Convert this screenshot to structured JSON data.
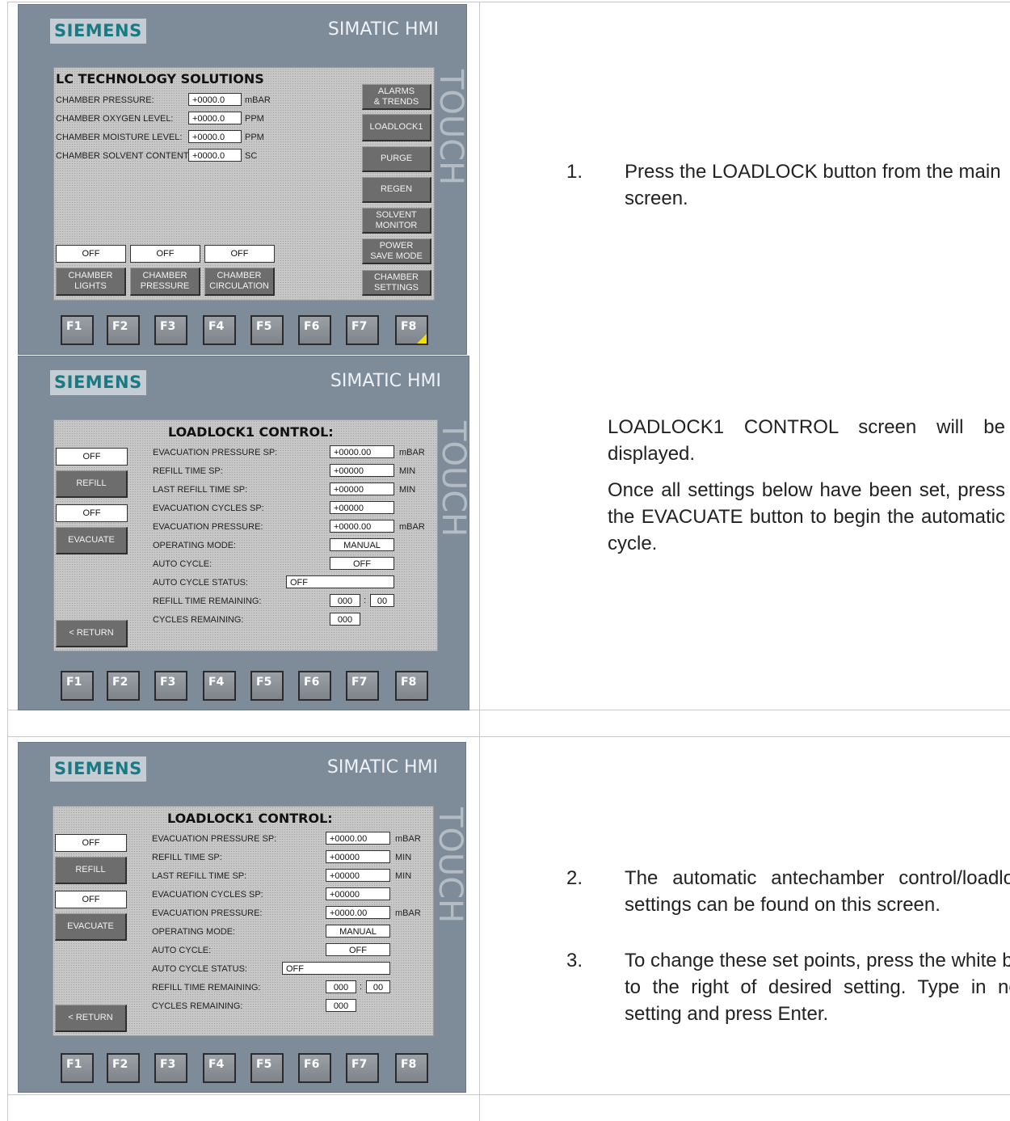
{
  "hmi": {
    "logo": "SIEMENS",
    "brand": "SIMATIC HMI",
    "touch": "TOUCH",
    "fkeys": [
      "F1",
      "F2",
      "F3",
      "F4",
      "F5",
      "F6",
      "F7",
      "F8"
    ]
  },
  "main_screen": {
    "title": "LC TECHNOLOGY SOLUTIONS",
    "readings": [
      {
        "label": "CHAMBER PRESSURE:",
        "value": "+0000.0",
        "unit": "mBAR"
      },
      {
        "label": "CHAMBER OXYGEN LEVEL:",
        "value": "+0000.0",
        "unit": "PPM"
      },
      {
        "label": "CHAMBER MOISTURE LEVEL:",
        "value": "+0000.0",
        "unit": "PPM"
      },
      {
        "label": "CHAMBER SOLVENT CONTENT:",
        "value": "+0000.0",
        "unit": "SC"
      }
    ],
    "side_buttons": [
      {
        "line1": "ALARMS",
        "line2": "& TRENDS"
      },
      {
        "line1": "LOADLOCK1",
        "line2": ""
      },
      {
        "line1": "PURGE",
        "line2": ""
      },
      {
        "line1": "REGEN",
        "line2": ""
      },
      {
        "line1": "SOLVENT",
        "line2": "MONITOR"
      },
      {
        "line1": "POWER",
        "line2": "SAVE MODE"
      },
      {
        "line1": "CHAMBER",
        "line2": "SETTINGS"
      }
    ],
    "status": [
      "OFF",
      "OFF",
      "OFF"
    ],
    "bottom_buttons": [
      {
        "line1": "CHAMBER",
        "line2": "LIGHTS"
      },
      {
        "line1": "CHAMBER",
        "line2": "PRESSURE"
      },
      {
        "line1": "CHAMBER",
        "line2": "CIRCULATION"
      }
    ]
  },
  "loadlock_screen": {
    "title": "LOADLOCK1 CONTROL:",
    "refill_status": "OFF",
    "refill_button": "REFILL",
    "evacuate_status": "OFF",
    "evacuate_button": "EVACUATE",
    "return_button": "< RETURN",
    "rows": [
      {
        "label": "EVACUATION PRESSURE SP:",
        "value": "+0000.00",
        "unit": "mBAR"
      },
      {
        "label": "REFILL TIME SP:",
        "value": "+00000",
        "unit": "MIN"
      },
      {
        "label": "LAST REFILL TIME SP:",
        "value": "+00000",
        "unit": "MIN"
      },
      {
        "label": "EVACUATION CYCLES SP:",
        "value": "+00000",
        "unit": ""
      },
      {
        "label": "EVACUATION PRESSURE:",
        "value": "+0000.00",
        "unit": "mBAR"
      },
      {
        "label": "OPERATING MODE:",
        "value": "MANUAL",
        "unit": ""
      },
      {
        "label": "AUTO CYCLE:",
        "value": "OFF",
        "unit": ""
      }
    ],
    "auto_cycle_status_label": "AUTO CYCLE STATUS:",
    "auto_cycle_status_value": "OFF",
    "refill_remaining_label": "REFILL TIME REMAINING:",
    "refill_remaining_min": "000",
    "refill_remaining_sep": ":",
    "refill_remaining_sec": "00",
    "cycles_remaining_label": "CYCLES REMAINING:",
    "cycles_remaining_value": "000"
  },
  "instructions": {
    "step1_num": "1.",
    "step1_text": "Press the LOADLOCK button from the main screen.",
    "displayed_text": "LOADLOCK1 CONTROL screen will be displayed.",
    "once_text": "Once all settings below have been set, press the EVACUATE button to begin the automatic cycle.",
    "step2_num": "2.",
    "step2_text": "The automatic antechamber control/loadlock settings can be found on this screen.",
    "step3_num": "3.",
    "step3_text": "To change these set points, press the white box to the right of desired setting. Type in new setting and press Enter."
  }
}
